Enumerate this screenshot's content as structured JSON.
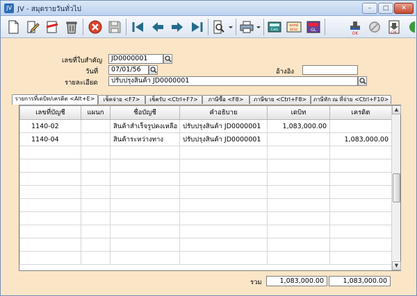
{
  "window": {
    "title": "JV - สมุดรายวันทั่วไป",
    "app_icon_text": "JV"
  },
  "toolbar": {
    "buttons": [
      {
        "name": "new-document-icon"
      },
      {
        "name": "edit-icon"
      },
      {
        "name": "cancel-document-icon"
      },
      {
        "name": "delete-trash-icon"
      },
      {
        "name": "close-red-icon"
      },
      {
        "name": "save-disk-icon"
      },
      {
        "name": "first-record-icon"
      },
      {
        "name": "previous-record-icon"
      },
      {
        "name": "next-record-icon"
      },
      {
        "name": "last-record-icon"
      },
      {
        "name": "search-document-icon"
      },
      {
        "name": "print-icon"
      },
      {
        "name": "calculator-icon",
        "label": "Calc"
      },
      {
        "name": "name-desc-icon",
        "label": "NAME DESC"
      },
      {
        "name": "gl-icon",
        "label": "GL"
      },
      {
        "name": "ok-stamp-icon",
        "label": "OK"
      },
      {
        "name": "disabled-tool-icon"
      },
      {
        "name": "ok-document-icon",
        "label": "OK"
      }
    ]
  },
  "form": {
    "doc_no_label": "เลขที่ใบสำคัญ",
    "doc_no_value": "JD0000001",
    "date_label": "วันที่",
    "date_value": "07/01/56",
    "ref_label": "อ้างอิง",
    "ref_value": "",
    "detail_label": "รายละเอียด",
    "detail_value": "ปรับปรุงสินค้า JD0000001"
  },
  "tabs": [
    {
      "label": "รายการที่เดบิท/เครดิต <Alt+E>",
      "active": true
    },
    {
      "label": "เช็คจ่าย <F7>",
      "active": false
    },
    {
      "label": "เช็ครับ <Ctrl+F7>",
      "active": false
    },
    {
      "label": "ภาษีซื้อ <F8>",
      "active": false
    },
    {
      "label": "ภาษีขาย <Ctrl+F8>",
      "active": false
    },
    {
      "label": "ภาษีหัก ณ ที่จ่าย <Ctrl+F10>",
      "active": false
    }
  ],
  "grid": {
    "columns": [
      "เลขที่บัญชี",
      "แผนก",
      "ชื่อบัญชี",
      "คำอธิบาย",
      "เดบิท",
      "เครดิต"
    ],
    "rows": [
      {
        "account": "1140-02",
        "dept": "",
        "name": "สินค้าสำเร็จรูปคงเหลือ",
        "desc": "ปรับปรุงสินค้า JD0000001",
        "debit": "1,083,000.00",
        "credit": ""
      },
      {
        "account": "1140-04",
        "dept": "",
        "name": "สินค้าระหว่างทาง",
        "desc": "ปรับปรุงสินค้า JD0000001",
        "debit": "",
        "credit": "1,083,000.00"
      }
    ],
    "empty_rows": 9
  },
  "totals": {
    "label": "รวม",
    "debit": "1,083,000.00",
    "credit": "1,083,000.00"
  }
}
